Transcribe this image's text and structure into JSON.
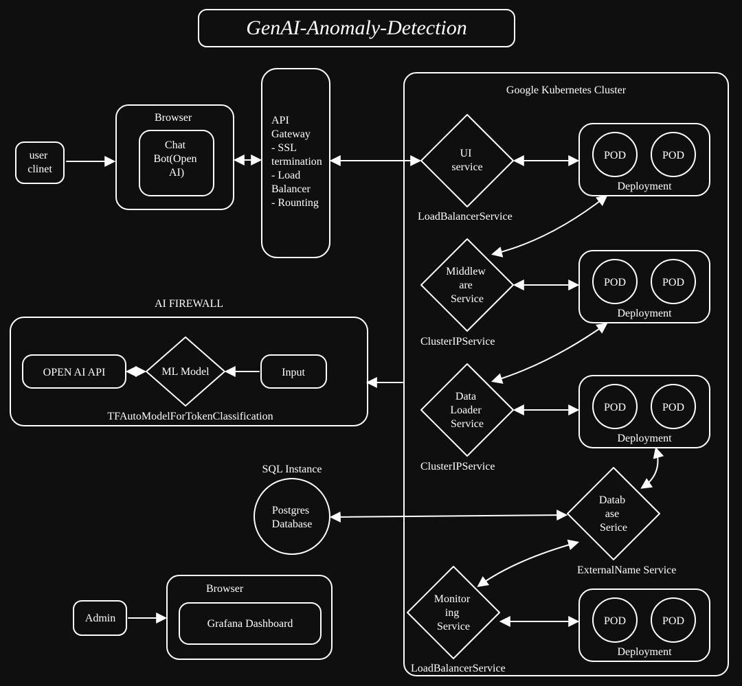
{
  "title": "GenAI-Anomaly-Detection",
  "user_client": "user\nclinet",
  "browser1_label": "Browser",
  "chatbot": "Chat\nBot(Open\nAI)",
  "api_gateway": "API\nGateway\n- SSL\ntermination\n- Load\nBalancer\n- Rounting",
  "cluster_label": "Google Kubernetes Cluster",
  "ui_service": "UI\nservice",
  "ui_service_type": "LoadBalancerService",
  "middleware_service": "Middlew\nare\nService",
  "middleware_service_type": "ClusterIPService",
  "dataloader_service": "Data\nLoader\nService",
  "dataloader_service_type": "ClusterIPService",
  "database_service": "Datab\nase\nSerice",
  "database_service_type": "ExternalName Service",
  "monitoring_service": "Monitor\ning\nService",
  "monitoring_service_type": "LoadBalancerService",
  "pod": "POD",
  "deployment": "Deployment",
  "ai_firewall_label": "AI FIREWALL",
  "openai_api": "OPEN AI API",
  "ml_model": "ML Model",
  "input_box": "Input",
  "ml_model_desc": "TFAutoModelForTokenClassification",
  "sql_instance_label": "SQL Instance",
  "postgres": "Postgres\nDatabase",
  "admin": "Admin",
  "browser2_label": "Browser",
  "grafana": "Grafana Dashboard"
}
